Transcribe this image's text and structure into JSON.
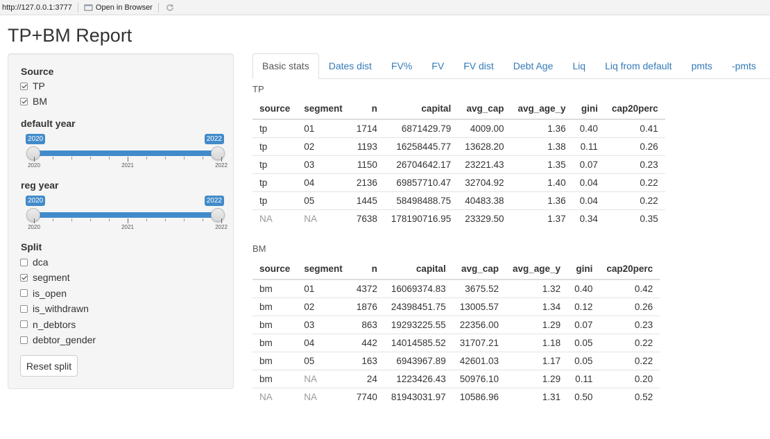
{
  "viewer": {
    "url": "http://127.0.0.1:3777",
    "open_in_browser": "Open in Browser"
  },
  "page": {
    "title": "TP+BM Report"
  },
  "sidebar": {
    "source_label": "Source",
    "source_options": [
      {
        "label": "TP",
        "checked": true
      },
      {
        "label": "BM",
        "checked": true
      }
    ],
    "default_year": {
      "label": "default year",
      "min": "2020",
      "max": "2022",
      "from": "2020",
      "to": "2022",
      "ticks": [
        "2020",
        "2021",
        "2022"
      ]
    },
    "reg_year": {
      "label": "reg year",
      "min": "2020",
      "max": "2022",
      "from": "2020",
      "to": "2022",
      "ticks": [
        "2020",
        "2021",
        "2022"
      ]
    },
    "split_label": "Split",
    "split_options": [
      {
        "label": "dca",
        "checked": false
      },
      {
        "label": "segment",
        "checked": true
      },
      {
        "label": "is_open",
        "checked": false
      },
      {
        "label": "is_withdrawn",
        "checked": false
      },
      {
        "label": "n_debtors",
        "checked": false
      },
      {
        "label": "debtor_gender",
        "checked": false
      }
    ],
    "reset_label": "Reset split"
  },
  "tabs": [
    {
      "label": "Basic stats",
      "active": true
    },
    {
      "label": "Dates dist",
      "active": false
    },
    {
      "label": "FV%",
      "active": false
    },
    {
      "label": "FV",
      "active": false
    },
    {
      "label": "FV dist",
      "active": false
    },
    {
      "label": "Debt Age",
      "active": false
    },
    {
      "label": "Liq",
      "active": false
    },
    {
      "label": "Liq from default",
      "active": false
    },
    {
      "label": "pmts",
      "active": false
    },
    {
      "label": "-pmts",
      "active": false
    }
  ],
  "tp": {
    "title": "TP",
    "headers": [
      "source",
      "segment",
      "n",
      "capital",
      "avg_cap",
      "avg_age_y",
      "gini",
      "cap20perc"
    ],
    "rows": [
      [
        "tp",
        "01",
        "1714",
        "6871429.79",
        "4009.00",
        "1.36",
        "0.40",
        "0.41"
      ],
      [
        "tp",
        "02",
        "1193",
        "16258445.77",
        "13628.20",
        "1.38",
        "0.11",
        "0.26"
      ],
      [
        "tp",
        "03",
        "1150",
        "26704642.17",
        "23221.43",
        "1.35",
        "0.07",
        "0.23"
      ],
      [
        "tp",
        "04",
        "2136",
        "69857710.47",
        "32704.92",
        "1.40",
        "0.04",
        "0.22"
      ],
      [
        "tp",
        "05",
        "1445",
        "58498488.75",
        "40483.38",
        "1.36",
        "0.04",
        "0.22"
      ],
      [
        "NA",
        "NA",
        "7638",
        "178190716.95",
        "23329.50",
        "1.37",
        "0.34",
        "0.35"
      ]
    ]
  },
  "bm": {
    "title": "BM",
    "headers": [
      "source",
      "segment",
      "n",
      "capital",
      "avg_cap",
      "avg_age_y",
      "gini",
      "cap20perc"
    ],
    "rows": [
      [
        "bm",
        "01",
        "4372",
        "16069374.83",
        "3675.52",
        "1.32",
        "0.40",
        "0.42"
      ],
      [
        "bm",
        "02",
        "1876",
        "24398451.75",
        "13005.57",
        "1.34",
        "0.12",
        "0.26"
      ],
      [
        "bm",
        "03",
        "863",
        "19293225.55",
        "22356.00",
        "1.29",
        "0.07",
        "0.23"
      ],
      [
        "bm",
        "04",
        "442",
        "14014585.52",
        "31707.21",
        "1.18",
        "0.05",
        "0.22"
      ],
      [
        "bm",
        "05",
        "163",
        "6943967.89",
        "42601.03",
        "1.17",
        "0.05",
        "0.22"
      ],
      [
        "bm",
        "NA",
        "24",
        "1223426.43",
        "50976.10",
        "1.29",
        "0.11",
        "0.20"
      ],
      [
        "NA",
        "NA",
        "7740",
        "81943031.97",
        "10586.96",
        "1.31",
        "0.50",
        "0.52"
      ]
    ]
  }
}
